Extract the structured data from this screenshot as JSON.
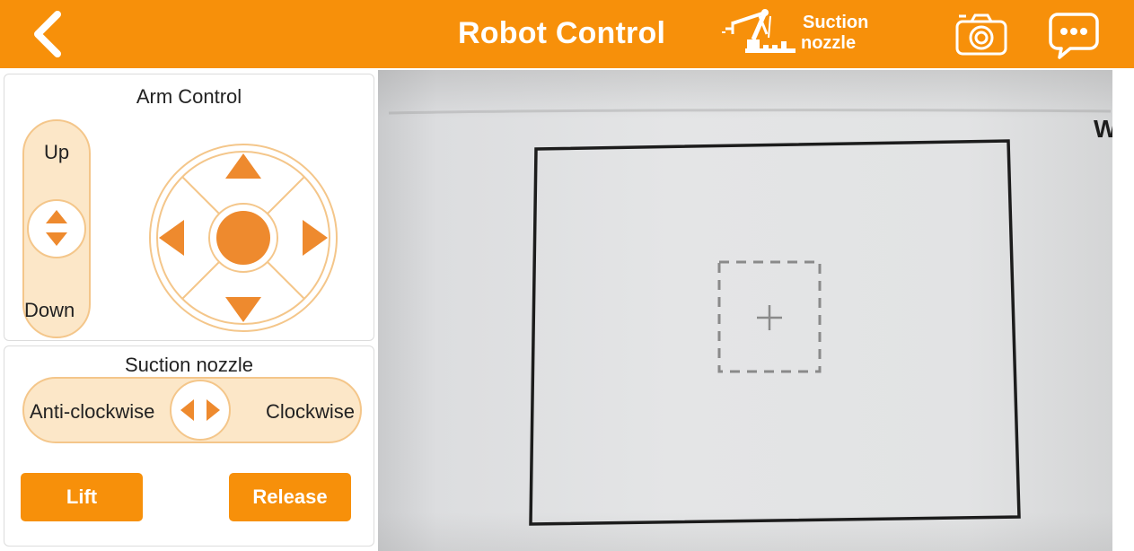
{
  "header": {
    "title": "Robot Control",
    "mode_label_line1": "Suction",
    "mode_label_line2": "nozzle",
    "bg_color": "#F7900A",
    "icons": [
      "back-chevron-icon",
      "robot-arm-icon",
      "camera-icon",
      "chat-bubble-icon"
    ]
  },
  "arm_control": {
    "title": "Arm Control",
    "up_label": "Up",
    "down_label": "Down"
  },
  "suction": {
    "title": "Suction nozzle",
    "anti_clockwise_label": "Anti-clockwise",
    "clockwise_label": "Clockwise",
    "lift_label": "Lift",
    "release_label": "Release"
  },
  "camera": {
    "edge_glyph": "W",
    "target_icon": "plus-crosshair-icon"
  },
  "colors": {
    "accent": "#F7900A",
    "control_orange": "#EE8A2E",
    "pill_fill": "#FCE7C8",
    "pill_border": "#F4C68A"
  }
}
